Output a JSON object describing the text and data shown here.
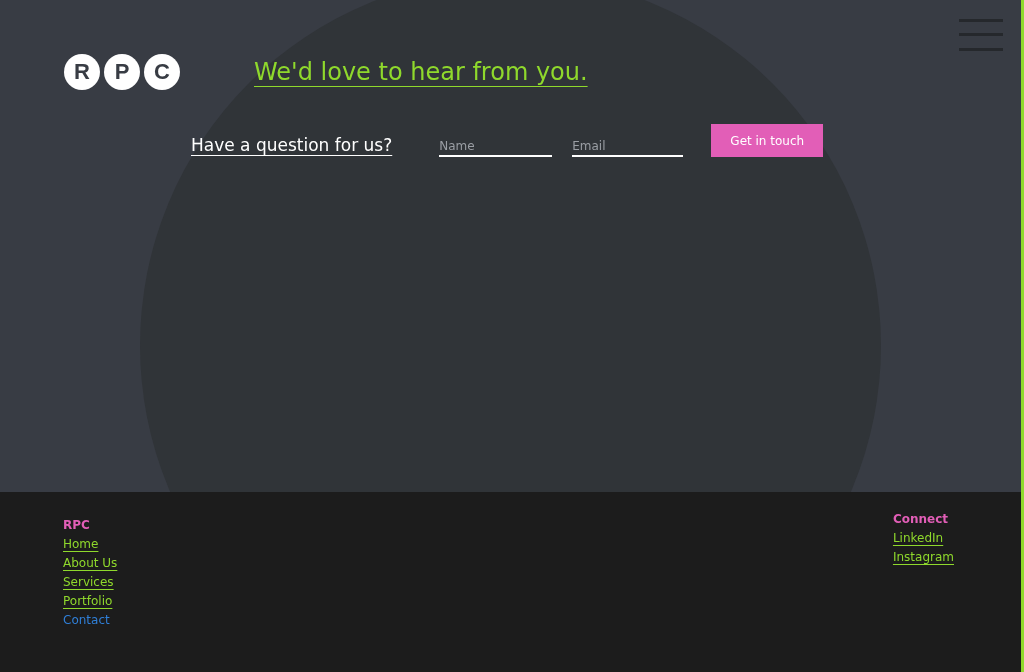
{
  "logo": {
    "letters": [
      "R",
      "P",
      "C"
    ]
  },
  "heading": "We'd love to hear from you.",
  "contact_form": {
    "prompt": "Have a question for us?",
    "name_field": {
      "placeholder": "Name"
    },
    "email_field": {
      "placeholder": "Email"
    },
    "submit_button": "Get in touch"
  },
  "footer": {
    "sections": [
      {
        "title": "RPC",
        "links": [
          {
            "label": "Home",
            "selected": false
          },
          {
            "label": "About Us",
            "selected": false
          },
          {
            "label": "Services",
            "selected": false
          },
          {
            "label": "Portfolio",
            "selected": false
          },
          {
            "label": "Contact",
            "selected": true
          }
        ]
      },
      {
        "title": "Connect",
        "links": [
          {
            "label": "LinkedIn",
            "selected": false
          },
          {
            "label": "Instagram",
            "selected": false
          }
        ]
      }
    ]
  }
}
